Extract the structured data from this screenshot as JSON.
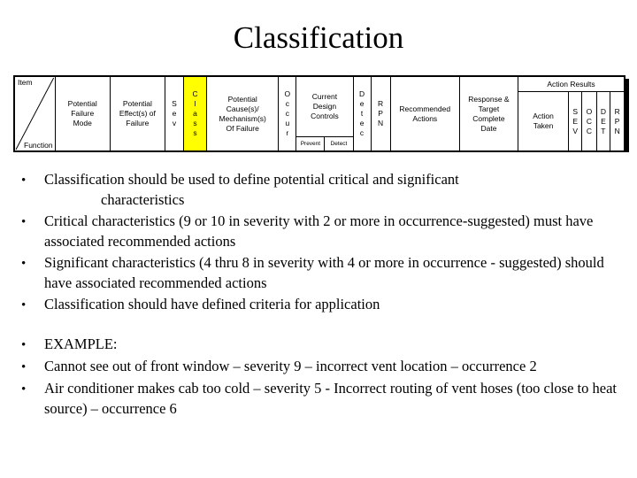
{
  "slide": {
    "title": "Classification"
  },
  "table": {
    "name": "fmea-header-table",
    "highlight_color": "#ffff00",
    "corner": {
      "item_label": "Item",
      "function_label": "Function"
    },
    "columns": [
      {
        "id": "potential-failure-mode",
        "label": "Potential\nFailure\nMode"
      },
      {
        "id": "potential-effects-of-failure",
        "label": "Potential\nEffect(s) of\nFailure"
      },
      {
        "id": "sev",
        "label": "S\ne\nv"
      },
      {
        "id": "class",
        "label": "C\nl\na\ns\ns",
        "highlighted": true
      },
      {
        "id": "potential-causes-mechanisms-of-failure",
        "label": "Potential\nCause(s)/\nMechanism(s)\nOf Failure"
      },
      {
        "id": "occur",
        "label": "O\nc\nc\nu\nr"
      },
      {
        "id": "current-design-controls",
        "label": "Current\nDesign\nControls",
        "sub": [
          {
            "id": "prevent",
            "label": "Prevent"
          },
          {
            "id": "detect",
            "label": "Detect"
          }
        ]
      },
      {
        "id": "detec",
        "label": "D\ne\nt\ne\nc"
      },
      {
        "id": "rpn",
        "label": "R\nP\nN"
      },
      {
        "id": "recommended-actions",
        "label": "Recommended\nActions"
      },
      {
        "id": "response-target-complete-date",
        "label": "Response &\nTarget\nComplete\nDate"
      }
    ],
    "action_results": {
      "group_label": "Action Results",
      "columns": [
        {
          "id": "action-taken",
          "label": "Action\nTaken"
        },
        {
          "id": "ar-sev",
          "label": "S\nE\nV"
        },
        {
          "id": "ar-occ",
          "label": "O\nC\nC"
        },
        {
          "id": "ar-det",
          "label": "D\nE\nT"
        },
        {
          "id": "ar-rpn",
          "label": "R\nP\nN"
        }
      ]
    }
  },
  "body": {
    "bullet_glyph": "•",
    "bullets": [
      {
        "id": "bullet-classification-define",
        "line1": "Classification should be used to define potential critical and significant",
        "line2": "characteristics"
      },
      {
        "id": "bullet-critical-characteristics",
        "line1": "Critical characteristics (9 or 10 in severity with 2 or more in occurrence-suggested) must have associated recommended actions"
      },
      {
        "id": "bullet-significant-characteristics",
        "line1": "Significant characteristics (4 thru 8 in severity with 4 or more in occurrence - suggested) should have associated recommended actions"
      },
      {
        "id": "bullet-defined-criteria",
        "line1": "Classification should have defined criteria for application"
      }
    ],
    "examples": [
      {
        "id": "bullet-example-heading",
        "line1": "EXAMPLE:"
      },
      {
        "id": "bullet-example-window",
        "line1": "Cannot see out of front window – severity 9 – incorrect vent location – occurrence 2"
      },
      {
        "id": "bullet-example-air-conditioner",
        "line1": "Air conditioner makes cab too cold – severity 5 - Incorrect routing of vent hoses (too close to heat source) – occurrence 6"
      }
    ]
  }
}
